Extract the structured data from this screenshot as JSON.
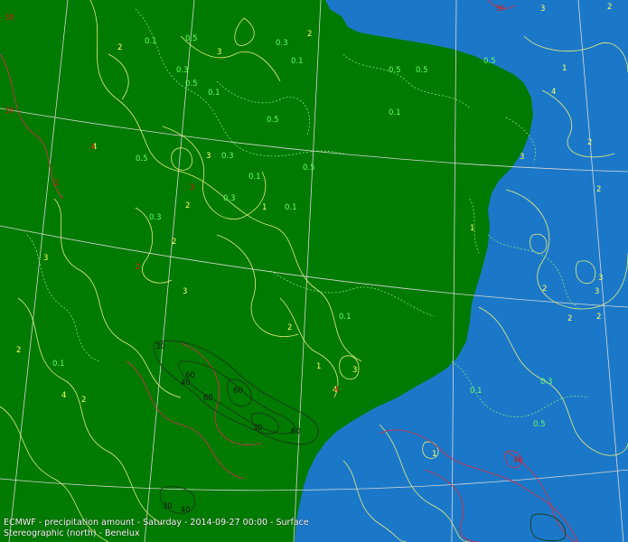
{
  "caption": {
    "line1": "ECMWF - precipitation amount - Saturday - 2014-09-27 00:00 - Surface",
    "line2": "Stereographic (north) - Benelux"
  },
  "colors": {
    "land": "#007a00",
    "sea": "#1b78c8",
    "contour_light": "#e6f07a",
    "contour_dashed": "#7fe07f",
    "contour_red": "#c8324a",
    "contour_dark": "#1a3a1a",
    "graticule": "#d8d8d8",
    "label_yellow": "#ffff66",
    "label_green": "#66ff66",
    "label_red": "#cc1a1a",
    "label_dark": "#0a1a0a"
  },
  "contour_values": {
    "yellow": [
      "2",
      "3",
      "4",
      "2",
      "3",
      "1",
      "2",
      "3",
      "4",
      "2",
      "1",
      "3",
      "2",
      "4",
      "3",
      "2",
      "1",
      "3",
      "2",
      "2",
      "3",
      "4",
      "2",
      "1",
      "2",
      "3",
      "2",
      "1",
      "2",
      "3",
      "2"
    ],
    "green": [
      "0.5",
      "0.1",
      "0.3",
      "0.5",
      "0.1",
      "0.5",
      "0.3",
      "0.1",
      "0.5",
      "0.5",
      "0.3",
      "0.1",
      "0.5",
      "0.1",
      "0.3",
      "0.5",
      "0.1",
      "0.1",
      "0.5",
      "0.3",
      "0.1",
      "0.5",
      "0.3",
      "0.1"
    ],
    "red": [
      "30",
      "4",
      "2",
      "3",
      "2",
      "4",
      "30",
      "40",
      "30"
    ],
    "dark": [
      "30",
      "60",
      "40",
      "60",
      "60",
      "30",
      "60",
      "30",
      "40"
    ]
  }
}
